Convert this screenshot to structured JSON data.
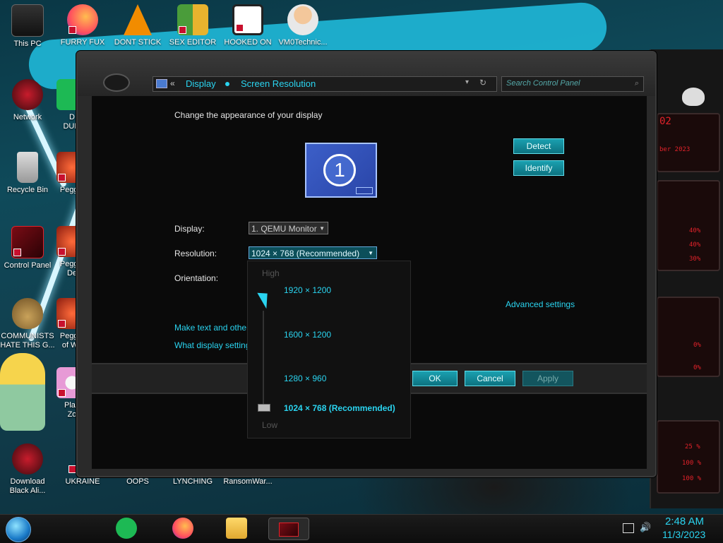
{
  "desktop": {
    "icons": [
      {
        "label": "This PC"
      },
      {
        "label": "FURRY FUX"
      },
      {
        "label": "DONT STICK"
      },
      {
        "label": "SEX EDITOR"
      },
      {
        "label": "HOOKED ON"
      },
      {
        "label": "VM0Technic..."
      },
      {
        "label": "Network"
      },
      {
        "label": "D\nDUM"
      },
      {
        "label": "Recycle Bin"
      },
      {
        "label": "Peggle"
      },
      {
        "label": "Control Panel"
      },
      {
        "label": "Peggle\nDe"
      },
      {
        "label": "COMMUNISTS\nHATE THIS G..."
      },
      {
        "label": "Peggle\nof Wa"
      },
      {
        "label": "Plan\nZo"
      },
      {
        "label": "Download\nBlack Ali..."
      },
      {
        "label": "UKRAINE"
      },
      {
        "label": "OOPS"
      },
      {
        "label": "LYNCHING"
      },
      {
        "label": "RansomWar..."
      }
    ],
    "side_panel": {
      "numbers": [
        "02",
        "ber 2023",
        "40%",
        "40%",
        "30%",
        "0%",
        "0%",
        "25 %",
        "100 %",
        "100 %"
      ]
    }
  },
  "window": {
    "address": {
      "back": "«",
      "crumbs": [
        "Display",
        "Screen Resolution"
      ]
    },
    "search_placeholder": "Search Control Panel",
    "heading": "Change the appearance of your display",
    "monitor_number": "1",
    "detect_label": "Detect",
    "identify_label": "Identify",
    "display_label": "Display:",
    "display_value": "1. QEMU Monitor",
    "resolution_label": "Resolution:",
    "resolution_value": "1024 × 768 (Recommended)",
    "orientation_label": "Orientation:",
    "advanced_link": "Advanced settings",
    "link_text_size": "Make text and other",
    "link_settings": "What display setting",
    "ok_label": "OK",
    "cancel_label": "Cancel",
    "apply_label": "Apply"
  },
  "resolution_dropdown": {
    "high_label": "High",
    "low_label": "Low",
    "options": [
      {
        "label": "1920 × 1200"
      },
      {
        "label": "1600 × 1200"
      },
      {
        "label": "1280 × 960"
      },
      {
        "label": "1024 × 768 (Recommended)"
      }
    ],
    "selected": 3
  },
  "taskbar": {
    "time": "2:48 AM",
    "date": "11/3/2023"
  },
  "colors": {
    "accent": "#2ad4f0",
    "button": "#1aa0b0",
    "alien_red": "#e2222a"
  }
}
